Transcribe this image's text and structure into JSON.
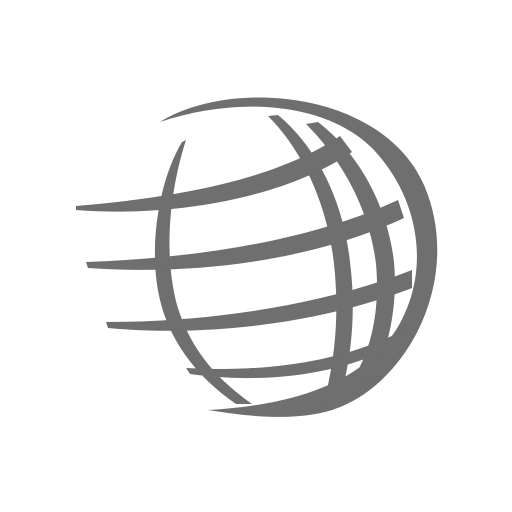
{
  "icon": {
    "name": "speeding-globe-icon",
    "color": "#6f6f6f",
    "background": "#ffffff"
  }
}
